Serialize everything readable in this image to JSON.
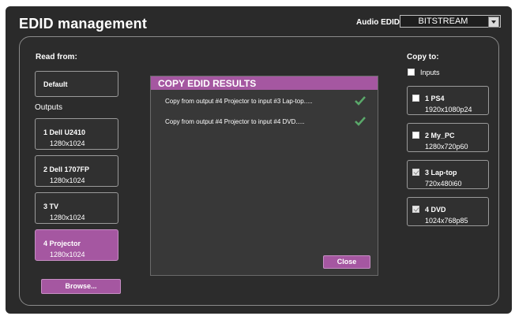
{
  "header": {
    "title": "EDID management",
    "audio_label": "Audio EDID",
    "audio_value": "BITSTREAM"
  },
  "read_from": {
    "label": "Read from:",
    "default_label": "Default",
    "outputs_label": "Outputs",
    "outputs": [
      {
        "name": "1   Dell U2410",
        "res": "1280x1024",
        "selected": false
      },
      {
        "name": "2   Dell 1707FP",
        "res": "1280x1024",
        "selected": false
      },
      {
        "name": "3   TV",
        "res": "1280x1024",
        "selected": false
      },
      {
        "name": "4   Projector",
        "res": "1280x1024",
        "selected": true
      }
    ],
    "browse_label": "Browse..."
  },
  "dialog": {
    "title": "COPY EDID RESULTS",
    "results": [
      "Copy from output #4 Projector to input #3 Lap-top.....",
      "Copy from output #4 Projector to input #4 DVD....."
    ],
    "close_label": "Close"
  },
  "copy_to": {
    "label": "Copy to:",
    "inputs_label": "Inputs",
    "inputs": [
      {
        "name": "1   PS4",
        "res": "1920x1080p24",
        "checked": false
      },
      {
        "name": "2   My_PC",
        "res": "1280x720p60",
        "checked": false
      },
      {
        "name": "3   Lap-top",
        "res": "720x480i60",
        "checked": true
      },
      {
        "name": "4   DVD",
        "res": "1024x768p85",
        "checked": true
      }
    ]
  },
  "colors": {
    "accent": "#a557a1",
    "background": "#2a2a2a",
    "check": "#5aa86a"
  }
}
